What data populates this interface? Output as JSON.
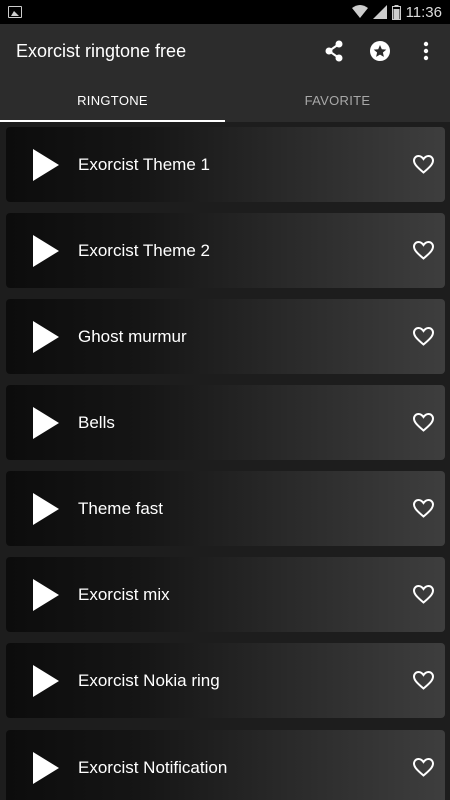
{
  "status_bar": {
    "time": "11:36",
    "icons": [
      "gallery-icon",
      "wifi-icon",
      "signal-icon",
      "battery-icon"
    ]
  },
  "toolbar": {
    "title": "Exorcist ringtone free",
    "actions": [
      "share-icon",
      "star-icon",
      "more-vert-icon"
    ]
  },
  "tabs": [
    {
      "label": "RINGTONE",
      "active": true
    },
    {
      "label": "FAVORITE",
      "active": false
    }
  ],
  "ringtones": [
    {
      "label": "Exorcist Theme 1"
    },
    {
      "label": "Exorcist Theme 2"
    },
    {
      "label": "Ghost murmur"
    },
    {
      "label": "Bells"
    },
    {
      "label": "Theme fast"
    },
    {
      "label": "Exorcist mix"
    },
    {
      "label": "Exorcist Nokia ring"
    },
    {
      "label": "Exorcist Notification"
    }
  ]
}
